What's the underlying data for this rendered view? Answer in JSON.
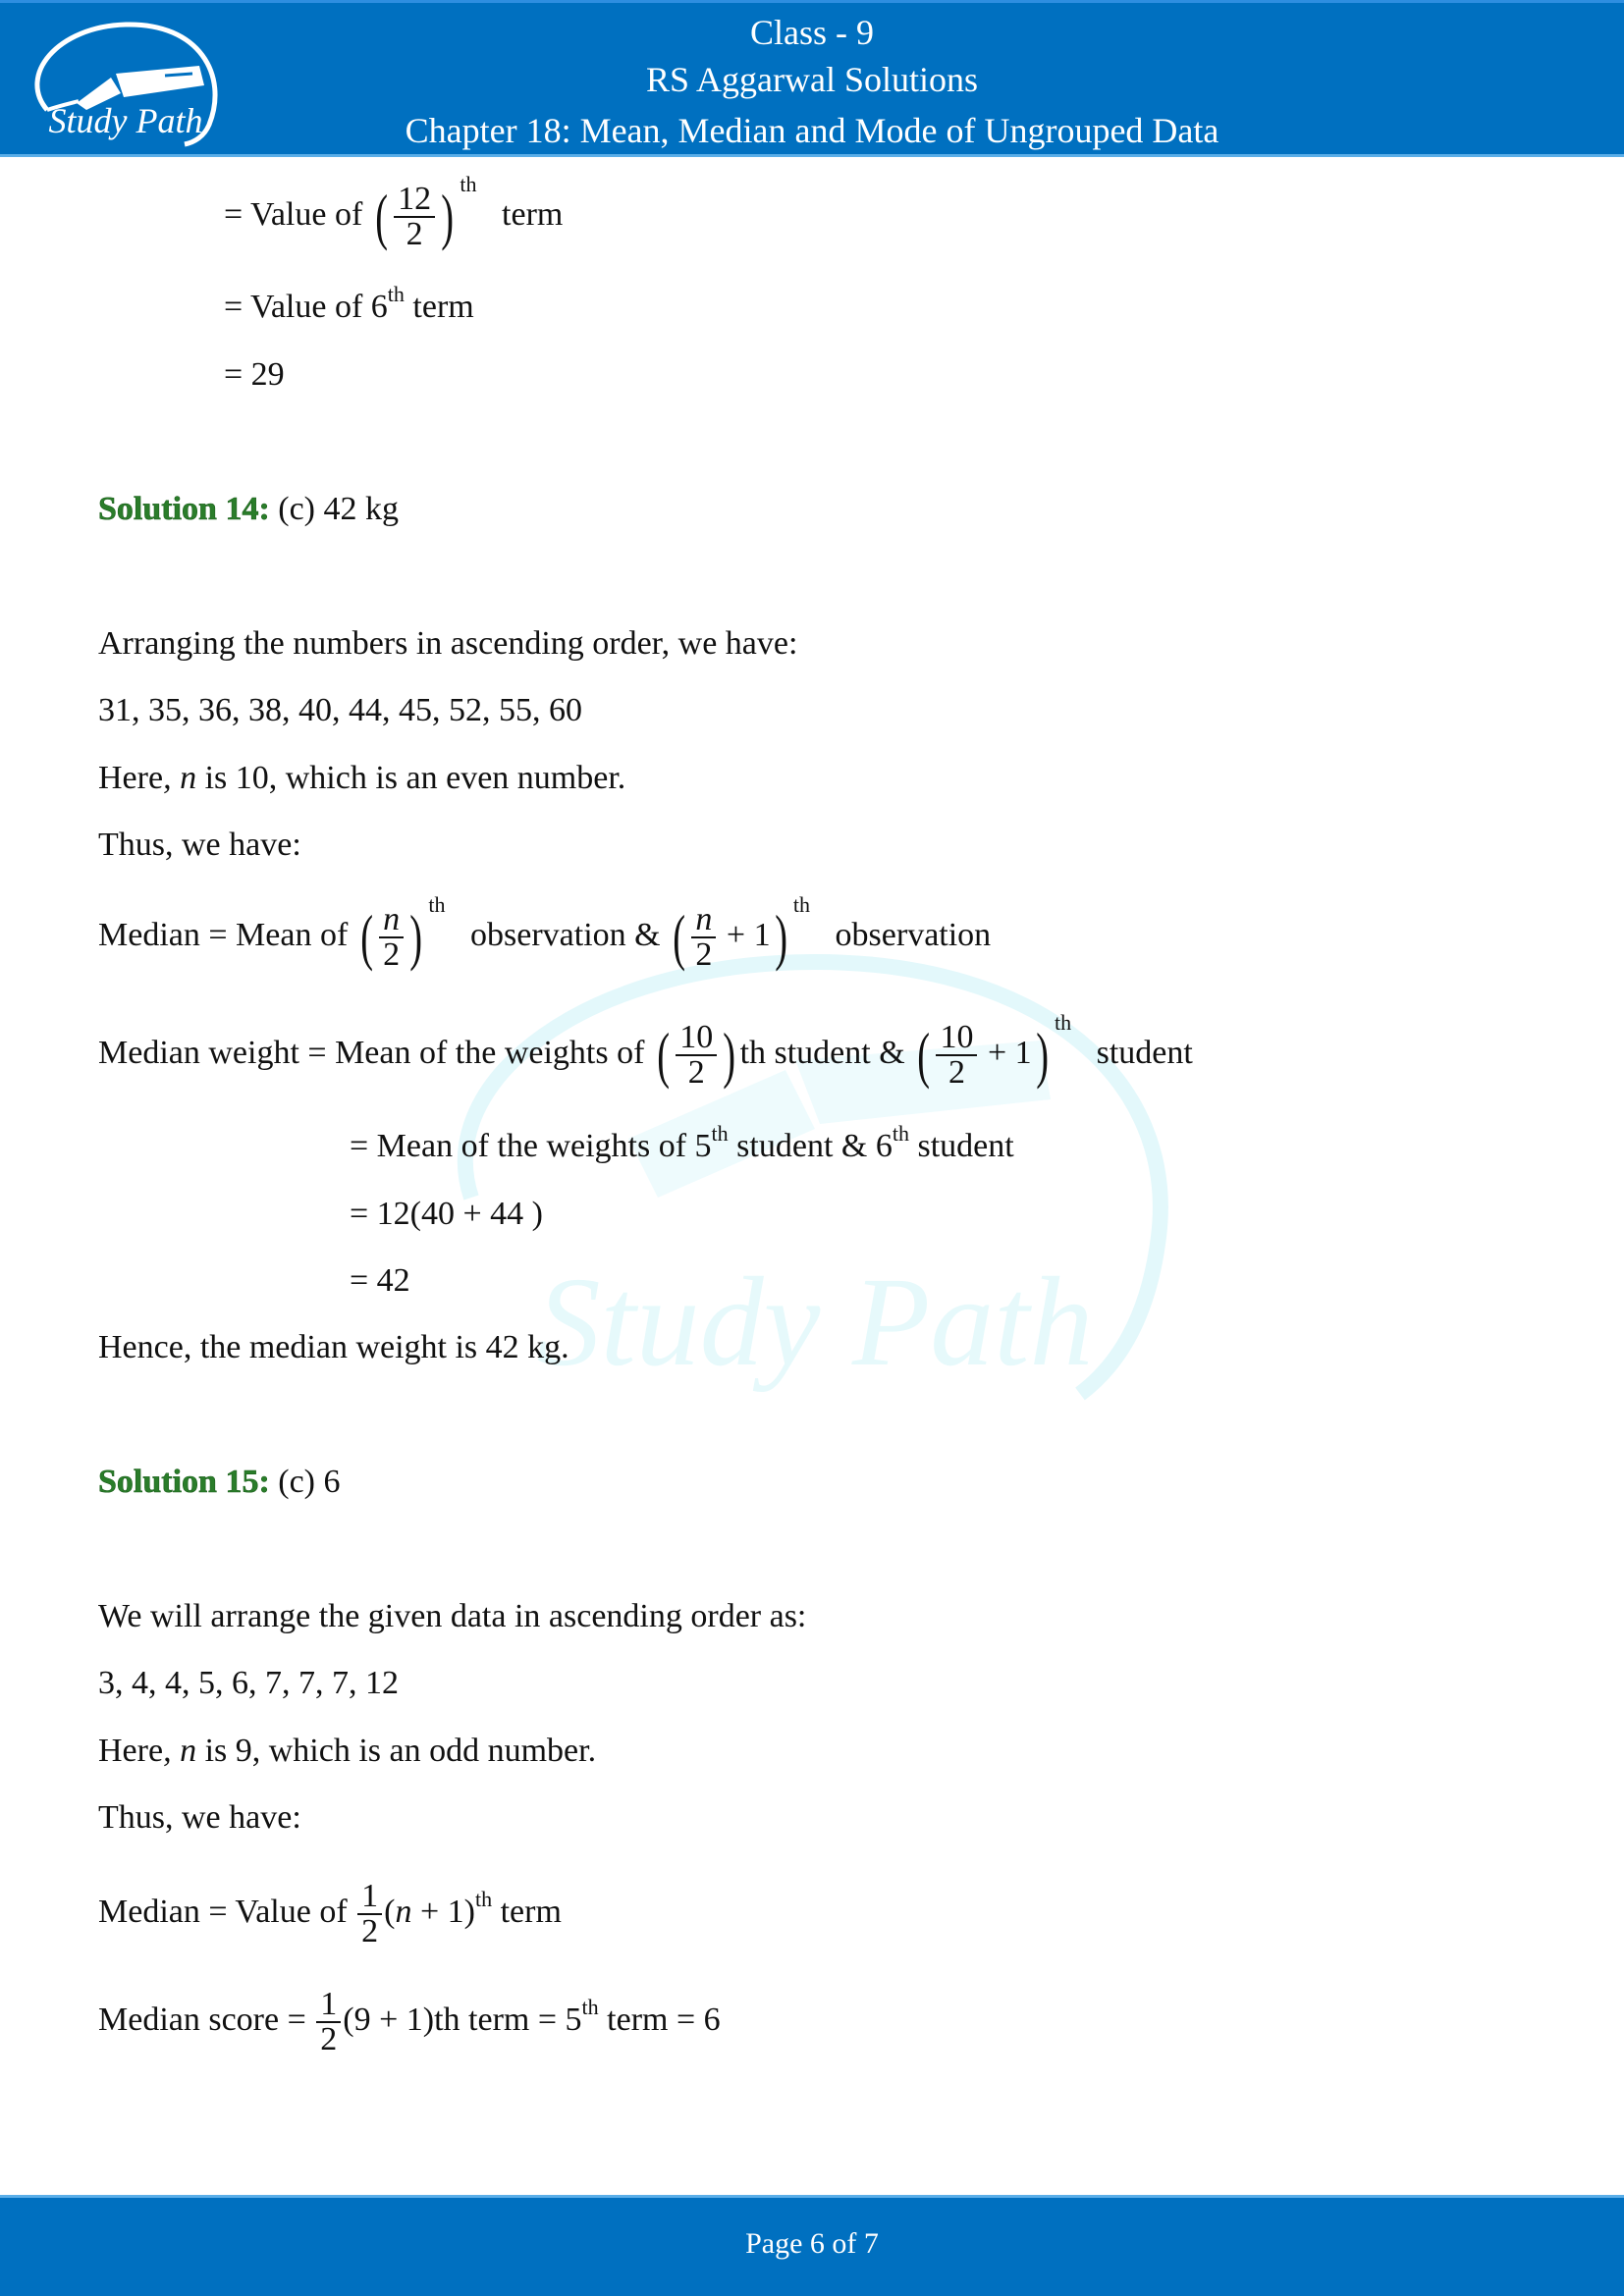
{
  "header": {
    "logo_text": "Study Path",
    "class_label": "Class - 9",
    "book_title": "RS Aggarwal Solutions",
    "chapter_title": "Chapter 18: Mean, Median and Mode of Ungrouped Data",
    "band_color": "#0070c0"
  },
  "watermark": {
    "text": "Study Path",
    "color": "#e6f9fb"
  },
  "continuation": {
    "line1": {
      "prefix": "= Value of",
      "numerator": "12",
      "denominator": "2",
      "sup": "th",
      "suffix": "term"
    },
    "line2": {
      "prefix": "= Value of 6",
      "sup": "th",
      "suffix": " term"
    },
    "line3": "= 29"
  },
  "solution14": {
    "label": "Solution 14:",
    "answer": "(c) 42 kg",
    "label_color": "#2a7d2a",
    "intro": "Arranging the numbers in ascending order, we have:",
    "numbers": "31, 35, 36, 38, 40, 44, 45, 52, 55, 60",
    "here_prefix": "Here",
    "here_var": "n",
    "here_suffix": " is 10, which is an even number.",
    "thus": "Thus, we have:",
    "median_formula": {
      "left": "Median = Mean of",
      "frac1_num": "n",
      "frac1_den": "2",
      "sup1": "th",
      "middle": "observation &",
      "frac2_num": "n",
      "frac2_den": "2",
      "plus_one": "+ 1",
      "sup2": "th",
      "right": "observation"
    },
    "median_weight": {
      "left": "Median weight = Mean of the weights of",
      "frac1_num": "10",
      "frac1_den": "2",
      "middle": "th student &",
      "frac2_num": "10",
      "frac2_den": "2",
      "plus_one": "+ 1",
      "sup2": "th",
      "right": "student"
    },
    "step1": {
      "prefix": "= Mean of the weights of 5",
      "sup1": "th",
      "mid": " student & 6",
      "sup2": "th",
      "suffix": " student"
    },
    "step2": "= 12(40 + 44 )",
    "step3": "= 42",
    "conclusion": "Hence, the median weight is 42 kg."
  },
  "solution15": {
    "label": "Solution 15:",
    "answer": "(c) 6",
    "intro": "We will arrange the given data in ascending order as:",
    "numbers": "3, 4, 4, 5, 6, 7, 7, 7, 12",
    "here_prefix": "Here",
    "here_var": "n",
    "here_suffix": " is 9, which is an odd number.",
    "thus": "Thus, we have:",
    "median_formula": {
      "left": "Median = Value of",
      "frac_num": "1",
      "frac_den": "2",
      "paren": "(",
      "var": "n",
      "paren_rest": " + 1)",
      "sup": "th",
      "right": " term"
    },
    "median_score": {
      "left": "Median score =",
      "frac_num": "1",
      "frac_den": "2",
      "mid": "(9 + 1)th term = 5",
      "sup": "th",
      "right": " term = 6"
    }
  },
  "footer": {
    "page_label": "Page 6 of 7"
  }
}
